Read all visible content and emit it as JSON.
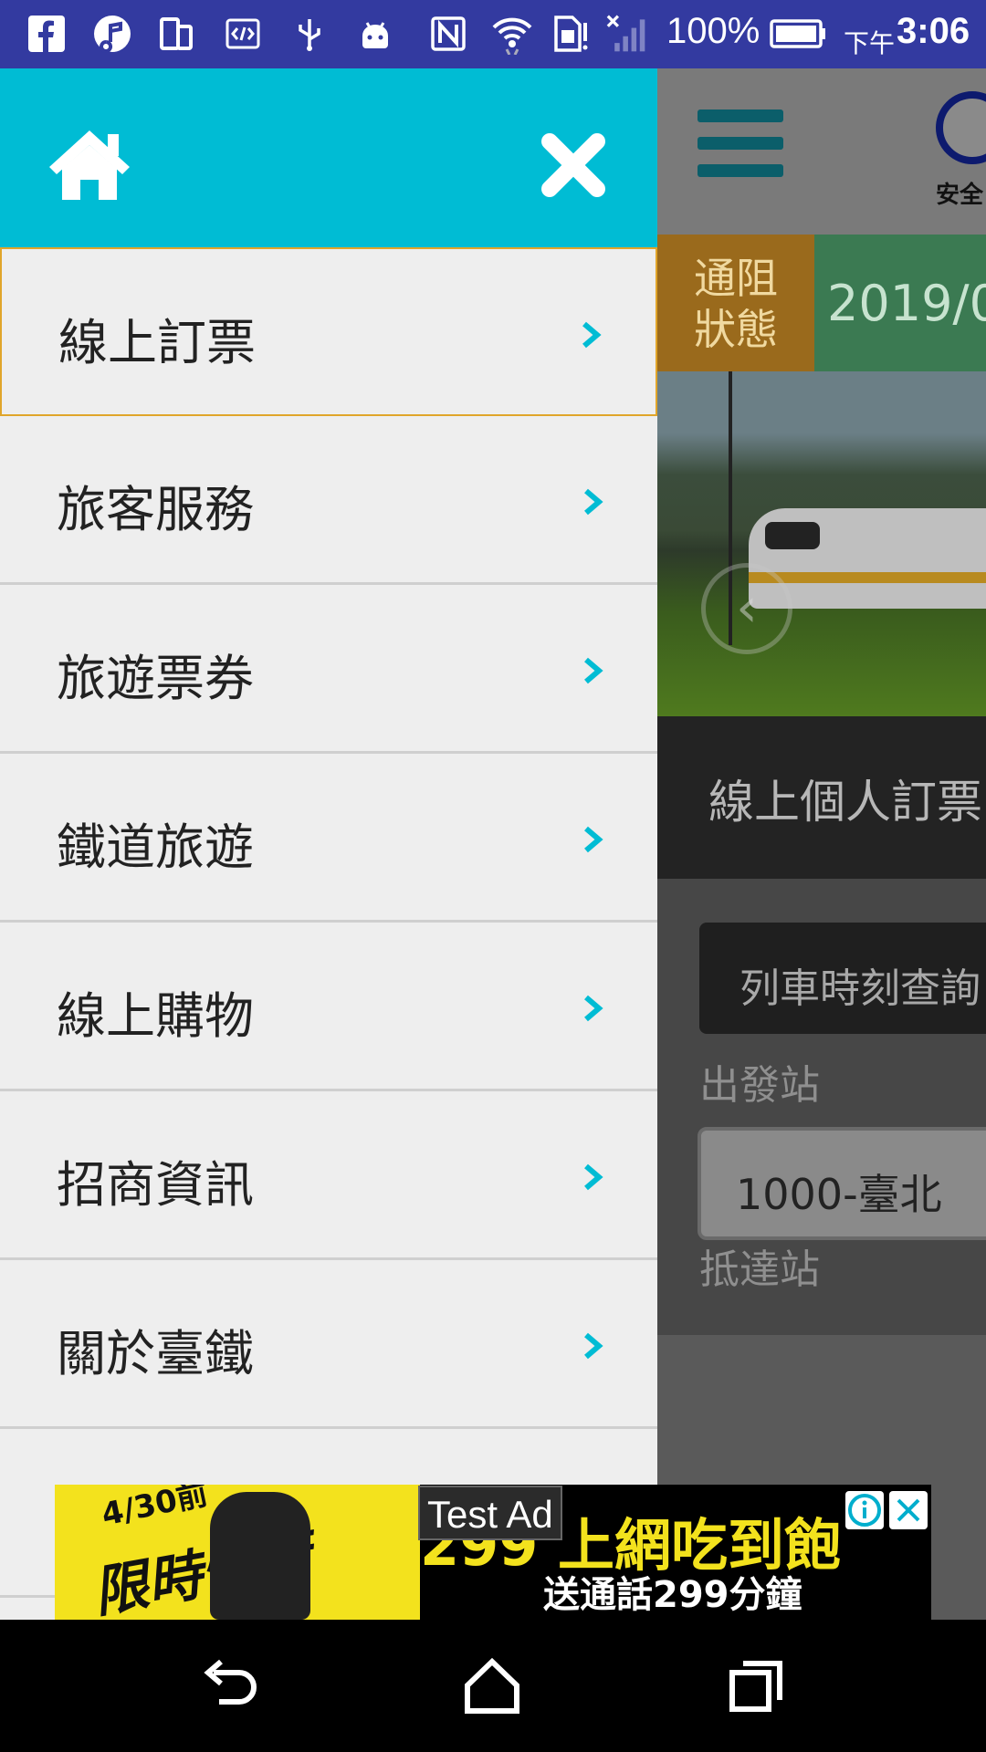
{
  "status_bar": {
    "battery": "100%",
    "period": "下午",
    "time": "3:06",
    "icons": [
      "facebook-icon",
      "music-app-icon",
      "dual-screen-icon",
      "code-icon",
      "usb-icon",
      "android-icon",
      "nfc-icon",
      "wifi-icon",
      "sim-icon",
      "no-signal-icon",
      "battery-icon"
    ]
  },
  "drawer": {
    "header_color": "#00bcd4",
    "active_border_color": "#e0a52a",
    "chevron_color": "#00bcd4",
    "menu_items": [
      {
        "label": "線上訂票"
      },
      {
        "label": "旅客服務"
      },
      {
        "label": "旅遊票券"
      },
      {
        "label": "鐵道旅遊"
      },
      {
        "label": "線上購物"
      },
      {
        "label": "招商資訊"
      },
      {
        "label": "關於臺鐵"
      }
    ]
  },
  "background_app": {
    "logo_caption": "安全",
    "alert_tag": "通阻狀態",
    "alert_tag_line1": "通阻",
    "alert_tag_line2": "狀態",
    "alert_date": "2019/0",
    "promo_title": "線上個人訂票",
    "query_button": "列車時刻查詢",
    "departure_label": "出發站",
    "departure_value": "1000-臺北",
    "arrival_label": "抵達站"
  },
  "ad": {
    "badge": "Test Ad",
    "left_small": "4/30前",
    "left_big": "限時快衝",
    "main_text": "299 上網吃到飽",
    "sub_text": "送通話299分鐘"
  }
}
